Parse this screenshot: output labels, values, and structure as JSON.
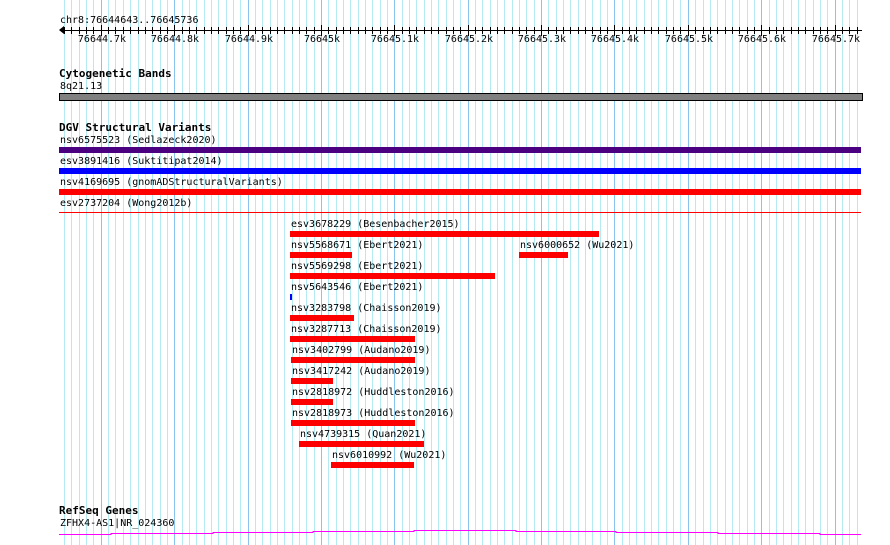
{
  "region": {
    "label": "chr8:76644643..76645736",
    "chrom": "chr8",
    "start": 76644643,
    "end": 76645736
  },
  "ruler": {
    "tick_labels": [
      "76644.7k",
      "76644.8k",
      "76644.9k",
      "76645k",
      "76645.1k",
      "76645.2k",
      "76645.3k",
      "76645.4k",
      "76645.5k",
      "76645.6k",
      "76645.7k"
    ]
  },
  "colors": {
    "grid_minor": "#b4eaf2",
    "grid_major": "#88c4ec",
    "dgv_red": "#ff0000",
    "dgv_blue": "#0000ff",
    "dgv_purple": "#4b0082",
    "gene": "#ff00ff",
    "band": "#808080"
  },
  "tracks": {
    "cytoband": {
      "title": "Cytogenetic Bands",
      "band": "8q21.13"
    },
    "dgv": {
      "title": "DGV Structural Variants",
      "features": [
        {
          "label": "nsv6575523 (Sedlazeck2020)",
          "start": 76644600,
          "end": 76645800,
          "color": "#4b0082",
          "row": 0
        },
        {
          "label": "esv3891416 (Suktitipat2014)",
          "start": 76644600,
          "end": 76645800,
          "color": "#0000ff",
          "row": 1
        },
        {
          "label": "nsv4169695 (gnomADStructuralVariants)",
          "start": 76644600,
          "end": 76645800,
          "color": "#ff0000",
          "row": 2
        },
        {
          "label": "esv2737204 (Wong2012b)",
          "start": 76644600,
          "end": 76645800,
          "color": "#ff0000",
          "row": 3,
          "thin": true
        },
        {
          "label": "esv3678229 (Besenbacher2015)",
          "start": 76644958,
          "end": 76645379,
          "color": "#ff0000",
          "row": 4
        },
        {
          "label": "nsv5568671 (Ebert2021)",
          "start": 76644958,
          "end": 76645042,
          "color": "#ff0000",
          "row": 5
        },
        {
          "label": "nsv6000652 (Wu2021)",
          "start": 76645270,
          "end": 76645337,
          "color": "#ff0000",
          "row": 5
        },
        {
          "label": "nsv5569298 (Ebert2021)",
          "start": 76644958,
          "end": 76645237,
          "color": "#ff0000",
          "row": 6
        },
        {
          "label": "nsv5643546 (Ebert2021)",
          "start": 76644958,
          "end": 76644961,
          "color": "#0000ff",
          "row": 7
        },
        {
          "label": "nsv3283798 (Chaisson2019)",
          "start": 76644958,
          "end": 76645045,
          "color": "#ff0000",
          "row": 8
        },
        {
          "label": "nsv3287713 (Chaisson2019)",
          "start": 76644958,
          "end": 76645128,
          "color": "#ff0000",
          "row": 9
        },
        {
          "label": "nsv3402799 (Audano2019)",
          "start": 76644959,
          "end": 76645128,
          "color": "#ff0000",
          "row": 10
        },
        {
          "label": "nsv3417242 (Audano2019)",
          "start": 76644959,
          "end": 76645016,
          "color": "#ff0000",
          "row": 11
        },
        {
          "label": "nsv2818972 (Huddleston2016)",
          "start": 76644959,
          "end": 76645016,
          "color": "#ff0000",
          "row": 12
        },
        {
          "label": "nsv2818973 (Huddleston2016)",
          "start": 76644959,
          "end": 76645128,
          "color": "#ff0000",
          "row": 13
        },
        {
          "label": "nsv4739315 (Quan2021)",
          "start": 76644970,
          "end": 76645140,
          "color": "#ff0000",
          "row": 14
        },
        {
          "label": "nsv6010992 (Wu2021)",
          "start": 76645014,
          "end": 76645127,
          "color": "#ff0000",
          "row": 15
        }
      ]
    },
    "refseq": {
      "title": "RefSeq Genes",
      "gene_label": "ZFHX4-AS1|NR_024360"
    }
  }
}
